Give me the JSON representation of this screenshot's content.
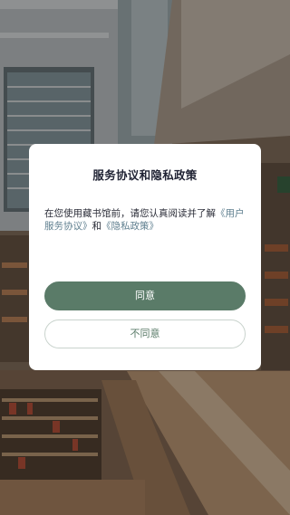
{
  "dialog": {
    "title": "服务协议和隐私政策",
    "body_text": "在您使用藏书馆前，请您认真阅读并了解",
    "link_user_agreement": "《用户服务协议》",
    "conjunction": "和",
    "link_privacy_policy": "《隐私政策》",
    "agree_label": "同意",
    "disagree_label": "不同意"
  },
  "colors": {
    "accent": "#5a7b68",
    "link": "#5f7f8f",
    "title": "#1f2233"
  }
}
